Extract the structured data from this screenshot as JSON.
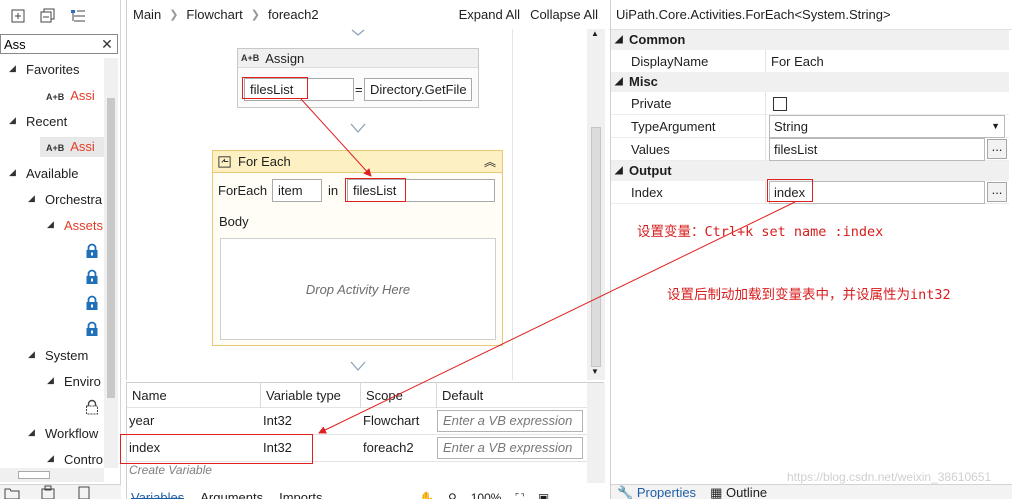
{
  "left_panel": {
    "search_value": "Ass",
    "tree": {
      "favorites": "Favorites",
      "favorites_item_prefix": "A+B",
      "favorites_item_match": "Assi",
      "recent": "Recent",
      "recent_item_prefix": "A+B",
      "recent_item_match": "Assi",
      "available": "Available",
      "orchestrator": "Orchestra",
      "assets_match": "Ass",
      "assets_rest": "ets",
      "system": "System",
      "environment": "Enviro",
      "workflow": "Workflow",
      "control": "Contro"
    }
  },
  "designer": {
    "breadcrumb": [
      "Main",
      "Flowchart",
      "foreach2"
    ],
    "expand_all": "Expand All",
    "collapse_all": "Collapse All",
    "assign": {
      "title": "Assign",
      "icon_label": "A+B",
      "to": "filesList",
      "equals": "=",
      "value": "Directory.GetFile"
    },
    "foreach": {
      "title": "For Each",
      "label": "ForEach",
      "item": "item",
      "in_label": "in",
      "values": "filesList",
      "body_label": "Body",
      "drop_hint": "Drop Activity Here"
    }
  },
  "variables": {
    "headers": [
      "Name",
      "Variable type",
      "Scope",
      "Default"
    ],
    "rows": [
      {
        "name": "year",
        "type": "Int32",
        "scope": "Flowchart",
        "default_placeholder": "Enter a VB expression"
      },
      {
        "name": "index",
        "type": "Int32",
        "scope": "foreach2",
        "default_placeholder": "Enter a VB expression"
      }
    ],
    "create_variable": "Create Variable",
    "tabs": [
      "Variables",
      "Arguments",
      "Imports"
    ],
    "zoom": "100%"
  },
  "properties": {
    "title": "UiPath.Core.Activities.ForEach<System.String>",
    "categories": {
      "common": "Common",
      "misc": "Misc",
      "output": "Output"
    },
    "display_name_label": "DisplayName",
    "display_name_value": "For Each",
    "private_label": "Private",
    "type_argument_label": "TypeArgument",
    "type_argument_value": "String",
    "values_label": "Values",
    "values_value": "filesList",
    "index_label": "Index",
    "index_value": "index",
    "ellipsis": "...",
    "bottom_tabs": [
      "Properties",
      "Outline"
    ]
  },
  "annotations": {
    "note1": "设置变量：Ctrl+k  set name :index",
    "note2": "设置后制动加载到变量表中，并设属性为int32",
    "watermark": "https://blog.csdn.net/weixin_38610651"
  },
  "colors": {
    "highlight": "#e02020",
    "foreach_header": "#fdf1c3",
    "annotation_text": "#d71d1d",
    "active_tab": "#1f5fa8"
  }
}
